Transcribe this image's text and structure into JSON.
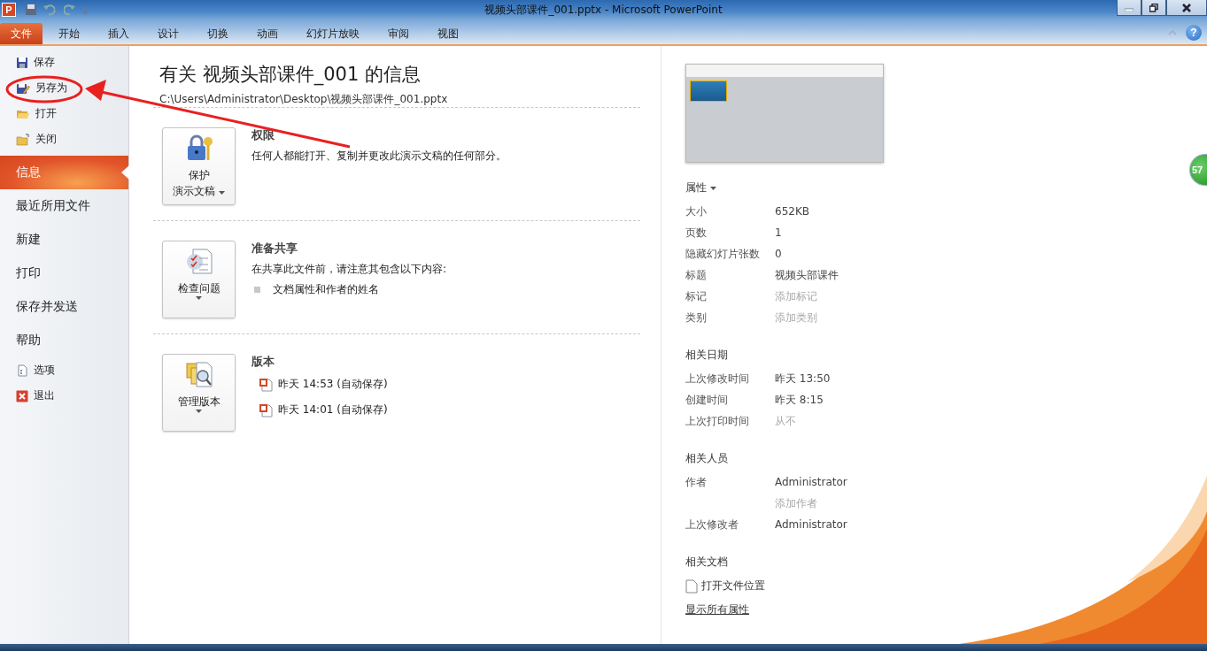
{
  "window": {
    "app_letter": "P",
    "title": "视频头部课件_001.pptx - Microsoft PowerPoint",
    "help": "?"
  },
  "ribbon_tabs": [
    {
      "label": "文件",
      "selected": true
    },
    {
      "label": "开始",
      "selected": false
    },
    {
      "label": "插入",
      "selected": false
    },
    {
      "label": "设计",
      "selected": false
    },
    {
      "label": "切换",
      "selected": false
    },
    {
      "label": "动画",
      "selected": false
    },
    {
      "label": "幻灯片放映",
      "selected": false
    },
    {
      "label": "审阅",
      "selected": false
    },
    {
      "label": "视图",
      "selected": false
    }
  ],
  "backstage_menu": {
    "commands_top": [
      {
        "label": "保存"
      },
      {
        "label": "另存为"
      },
      {
        "label": "打开"
      },
      {
        "label": "关闭"
      }
    ],
    "nav": [
      {
        "label": "信息",
        "selected": true
      },
      {
        "label": "最近所用文件",
        "selected": false
      },
      {
        "label": "新建",
        "selected": false
      },
      {
        "label": "打印",
        "selected": false
      },
      {
        "label": "保存并发送",
        "selected": false
      },
      {
        "label": "帮助",
        "selected": false
      }
    ],
    "commands_bottom": [
      {
        "label": "选项"
      },
      {
        "label": "退出"
      }
    ]
  },
  "info": {
    "title": "有关 视频头部课件_001 的信息",
    "path": "C:\\Users\\Administrator\\Desktop\\视频头部课件_001.pptx",
    "sections": [
      {
        "button_lines": [
          "保护",
          "演示文稿"
        ],
        "heading": "权限",
        "description": "任何人都能打开、复制并更改此演示文稿的任何部分。"
      },
      {
        "button_lines": [
          "检查问题"
        ],
        "heading": "准备共享",
        "description": "在共享此文件前，请注意其包含以下内容:",
        "bullets": [
          "文档属性和作者的姓名"
        ]
      },
      {
        "button_lines": [
          "管理版本"
        ],
        "heading": "版本",
        "versions": [
          "昨天 14:53 (自动保存)",
          "昨天 14:01 (自动保存)"
        ]
      }
    ]
  },
  "properties": {
    "heading": "属性",
    "rows": [
      {
        "label": "大小",
        "value": "652KB"
      },
      {
        "label": "页数",
        "value": "1"
      },
      {
        "label": "隐藏幻灯片张数",
        "value": "0"
      },
      {
        "label": "标题",
        "value": "视频头部课件"
      },
      {
        "label": "标记",
        "placeholder": "添加标记"
      },
      {
        "label": "类别",
        "placeholder": "添加类别"
      }
    ],
    "groups": [
      {
        "heading": "相关日期",
        "rows": [
          {
            "label": "上次修改时间",
            "value": "昨天 13:50"
          },
          {
            "label": "创建时间",
            "value": "昨天 8:15"
          },
          {
            "label": "上次打印时间",
            "placeholder": "从不"
          }
        ]
      },
      {
        "heading": "相关人员",
        "rows": [
          {
            "label": "作者",
            "value": "Administrator"
          },
          {
            "placeholder": "添加作者"
          },
          {
            "label": "上次修改者",
            "value": "Administrator"
          }
        ]
      }
    ],
    "related_heading": "相关文档",
    "open_location": "打开文件位置",
    "show_all": "显示所有属性"
  },
  "badge": "57"
}
